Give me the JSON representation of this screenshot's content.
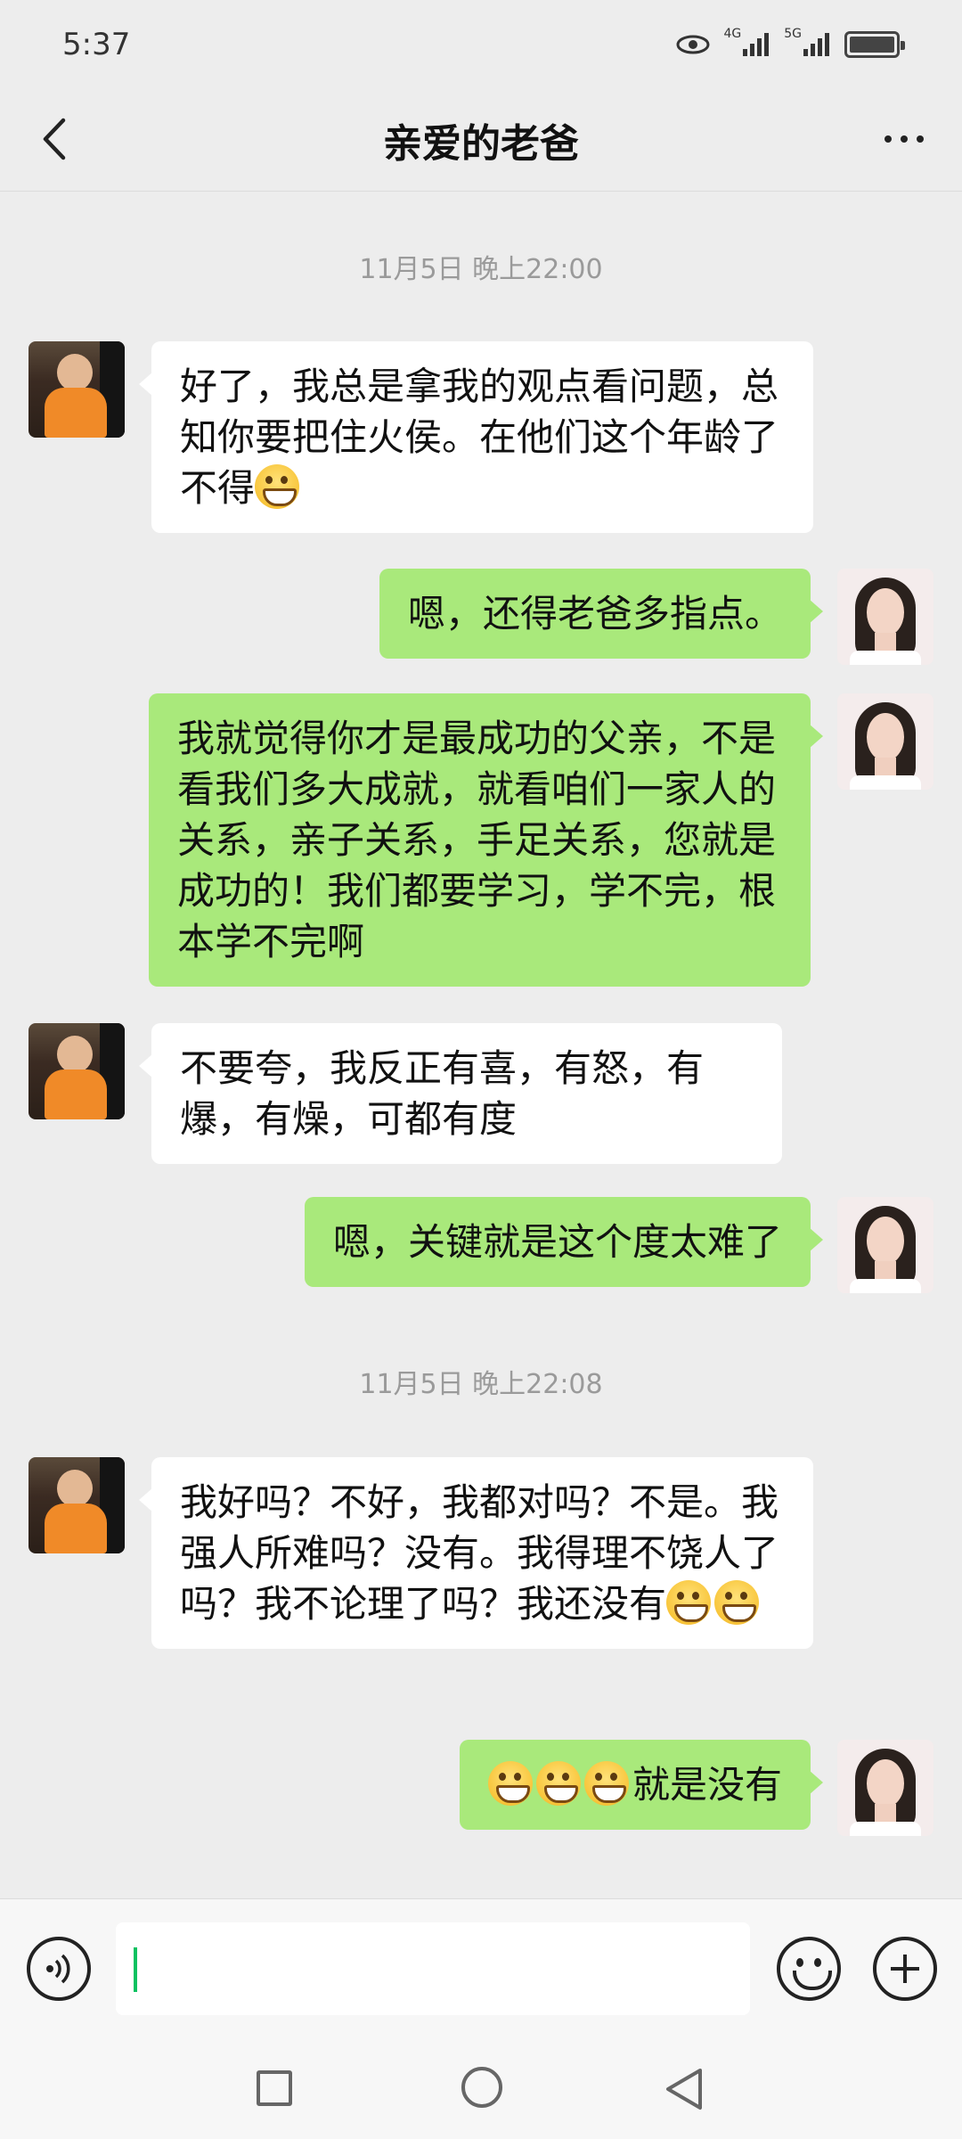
{
  "status_bar": {
    "time": "5:37",
    "net1": "4G",
    "net2": "5G",
    "icons": [
      "eye-icon",
      "signal-4g-icon",
      "signal-5g-icon",
      "battery-icon"
    ]
  },
  "header": {
    "title": "亲爱的老爸",
    "back_icon": "chevron-left-icon",
    "more_icon": "more-dots-icon"
  },
  "chat": {
    "timestamps": [
      "11月5日 晚上22:00",
      "11月5日 晚上22:08"
    ],
    "messages": [
      {
        "side": "left",
        "text": "好了，我总是拿我的观点看问题，总知你要把住火侯。在他们这个年龄了不得",
        "emoji_count": 1
      },
      {
        "side": "right",
        "text": "嗯，还得老爸多指点。",
        "emoji_count": 0
      },
      {
        "side": "right",
        "text": "我就觉得你才是最成功的父亲，不是看我们多大成就，就看咱们一家人的关系，亲子关系，手足关系，您就是成功的！我们都要学习，学不完，根本学不完啊",
        "emoji_count": 0
      },
      {
        "side": "left",
        "text": "不要夸，我反正有喜，有怒，有爆，有燥，可都有度",
        "emoji_count": 0
      },
      {
        "side": "right",
        "text": "嗯，关键就是这个度太难了",
        "emoji_count": 0
      },
      {
        "side": "left",
        "text": "我好吗？不好，我都对吗？不是。我强人所难吗？没有。我得理不饶人了吗？我不论理了吗？我还没有",
        "emoji_count": 2
      },
      {
        "side": "right",
        "text": "就是没有",
        "emoji_count": 3
      }
    ]
  },
  "input_bar": {
    "value": "",
    "voice_icon": "voice-icon",
    "emoji_icon": "emoji-icon",
    "plus_icon": "plus-icon"
  },
  "nav_bar": {
    "icons": [
      "recent-apps-icon",
      "home-icon",
      "back-icon"
    ]
  },
  "colors": {
    "background": "#ededed",
    "sent_bubble": "#a9e97b",
    "received_bubble": "#ffffff",
    "caret": "#07c160"
  }
}
